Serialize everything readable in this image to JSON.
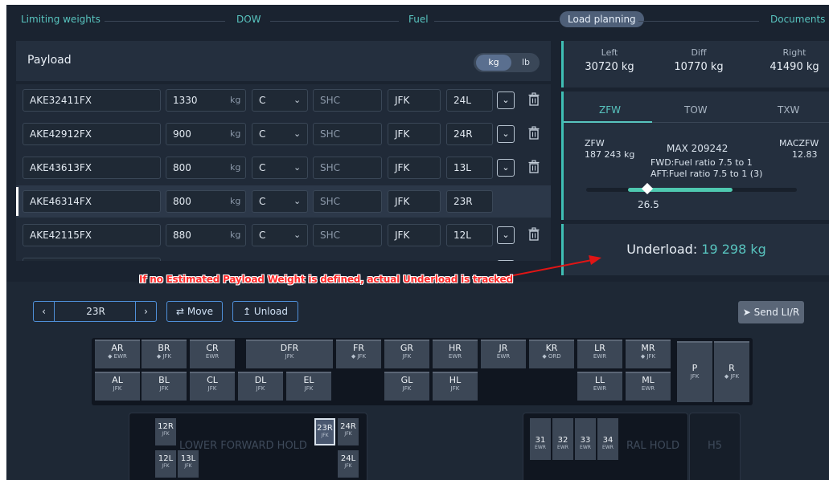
{
  "steps": [
    "Limiting weights",
    "DOW",
    "Fuel",
    "Load planning",
    "Documents"
  ],
  "payload": {
    "title": "Payload",
    "unit_kg": "kg",
    "unit_lb": "lb",
    "unit_label": "kg",
    "shc_placeholder": "SHC",
    "rows": [
      {
        "id": "AKE32411FX",
        "weight": "1330",
        "cls": "C",
        "dest": "JFK",
        "pos": "24L"
      },
      {
        "id": "AKE42912FX",
        "weight": "900",
        "cls": "C",
        "dest": "JFK",
        "pos": "24R"
      },
      {
        "id": "AKE43613FX",
        "weight": "800",
        "cls": "C",
        "dest": "JFK",
        "pos": "13L"
      },
      {
        "id": "AKE46314FX",
        "weight": "800",
        "cls": "C",
        "dest": "JFK",
        "pos": "23R"
      },
      {
        "id": "AKE42115FX",
        "weight": "880",
        "cls": "C",
        "dest": "JFK",
        "pos": "12L"
      }
    ]
  },
  "balance": {
    "left_label": "Left",
    "left_value": "30720 kg",
    "diff_label": "Diff",
    "diff_value": "10770 kg",
    "right_label": "Right",
    "right_value": "41490 kg"
  },
  "zfw": {
    "tabs": [
      "ZFW",
      "TOW",
      "TXW"
    ],
    "label": "ZFW",
    "value": "187 243 kg",
    "max": "MAX  209242",
    "fwd": "FWD:Fuel ratio 7.5 to 1",
    "aft": "AFT:Fuel ratio 7.5 to 1 (3)",
    "maczfw_label": "MACZFW",
    "maczfw_value": "12.83",
    "marker_value": "26.5"
  },
  "underload": {
    "label": "Underload:",
    "value": "19 298 kg"
  },
  "annotation": "If no Estimated Payload Weight is defined, actual Underload is tracked",
  "controls": {
    "prev": "‹",
    "position": "23R",
    "next": "›",
    "move_label": "⇄ Move",
    "unload_label": "↥ Unload",
    "send_label": "Send LI/R"
  },
  "main_deck": [
    {
      "name": "AR",
      "dest": "◆ EWR"
    },
    {
      "name": "BR",
      "dest": "◆ JFK"
    },
    {
      "name": "CR",
      "dest": "EWR"
    },
    {
      "name": "DFR",
      "dest": "JFK"
    },
    {
      "name": "FR",
      "dest": "◆ JFK"
    },
    {
      "name": "GR",
      "dest": "JFK"
    },
    {
      "name": "HR",
      "dest": "EWR"
    },
    {
      "name": "JR",
      "dest": "EWR"
    },
    {
      "name": "KR",
      "dest": "◆ ORD"
    },
    {
      "name": "LR",
      "dest": "EWR"
    },
    {
      "name": "MR",
      "dest": "◆ JFK"
    },
    {
      "name": "P",
      "dest": "JFK"
    },
    {
      "name": "R",
      "dest": "◆ JFK"
    },
    {
      "name": "AL",
      "dest": "JFK"
    },
    {
      "name": "BL",
      "dest": "JFK"
    },
    {
      "name": "CL",
      "dest": "JFK"
    },
    {
      "name": "DL",
      "dest": "JFK"
    },
    {
      "name": "EL",
      "dest": "JFK"
    },
    {
      "name": "GL",
      "dest": "JFK"
    },
    {
      "name": "HL",
      "dest": "JFK"
    },
    {
      "name": "LL",
      "dest": "EWR"
    },
    {
      "name": "ML",
      "dest": "EWR"
    }
  ],
  "lower_forward_hold": {
    "label": "LOWER FORWARD HOLD",
    "cells": [
      {
        "name": "12R",
        "dest": "JFK"
      },
      {
        "name": "12L",
        "dest": "JFK"
      },
      {
        "name": "13L",
        "dest": "JFK"
      },
      {
        "name": "23R",
        "dest": "JFK"
      },
      {
        "name": "24R",
        "dest": "JFK"
      },
      {
        "name": "24L",
        "dest": "JFK"
      }
    ]
  },
  "aft_hold": {
    "label": "RAL HOLD",
    "cells": [
      {
        "name": "31",
        "dest": "EWR"
      },
      {
        "name": "32",
        "dest": "EWR"
      },
      {
        "name": "33",
        "dest": "EWR"
      },
      {
        "name": "34",
        "dest": "EWR"
      }
    ]
  },
  "h5_label": "H5",
  "colors": {
    "accent": "#58c4bf",
    "background": "#1a2330",
    "panel": "#242f3e",
    "annotation": "#ff2a2a"
  }
}
